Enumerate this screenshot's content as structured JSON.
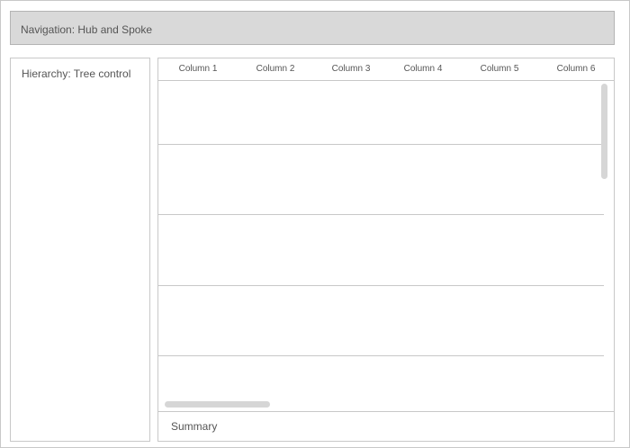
{
  "navigation": {
    "label": "Navigation: Hub and Spoke"
  },
  "hierarchy": {
    "label": "Hierarchy: Tree control"
  },
  "table": {
    "columns": [
      "Column 1",
      "Column 2",
      "Column 3",
      "Column 4",
      "Column 5",
      "Column 6"
    ],
    "row_count": 5
  },
  "summary": {
    "label": "Summary"
  }
}
